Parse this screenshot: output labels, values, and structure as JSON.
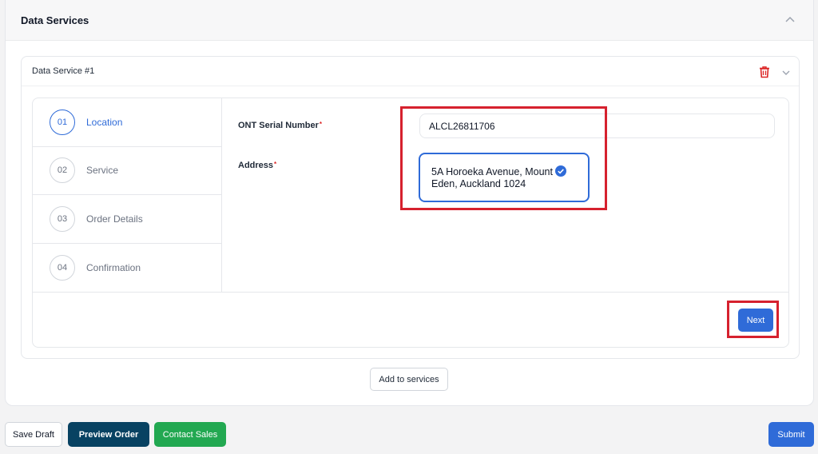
{
  "panel": {
    "title": "Data Services"
  },
  "service_card": {
    "title": "Data Service #1"
  },
  "steps": [
    {
      "num": "01",
      "label": "Location",
      "active": true
    },
    {
      "num": "02",
      "label": "Service",
      "active": false
    },
    {
      "num": "03",
      "label": "Order Details",
      "active": false
    },
    {
      "num": "04",
      "label": "Confirmation",
      "active": false
    }
  ],
  "form": {
    "ont_label": "ONT Serial Number",
    "ont_value": "ALCL26811706",
    "address_label": "Address",
    "address_line1": "5A Horoeka Avenue, Mount",
    "address_line2": "Eden, Auckland 1024",
    "required_marker": "*"
  },
  "buttons": {
    "next": "Next",
    "add_to_services": "Add to services",
    "save_draft": "Save Draft",
    "preview_order": "Preview Order",
    "contact_sales": "Contact Sales",
    "submit": "Submit"
  },
  "icons": {
    "collapse": "chevron-up-icon",
    "delete": "trash-icon",
    "expand": "chevron-down-icon",
    "verified": "check-circle-icon"
  },
  "colors": {
    "primary": "#2f6bd8",
    "danger": "#d6212e",
    "dark_button": "#084262",
    "success_button": "#22a851"
  }
}
